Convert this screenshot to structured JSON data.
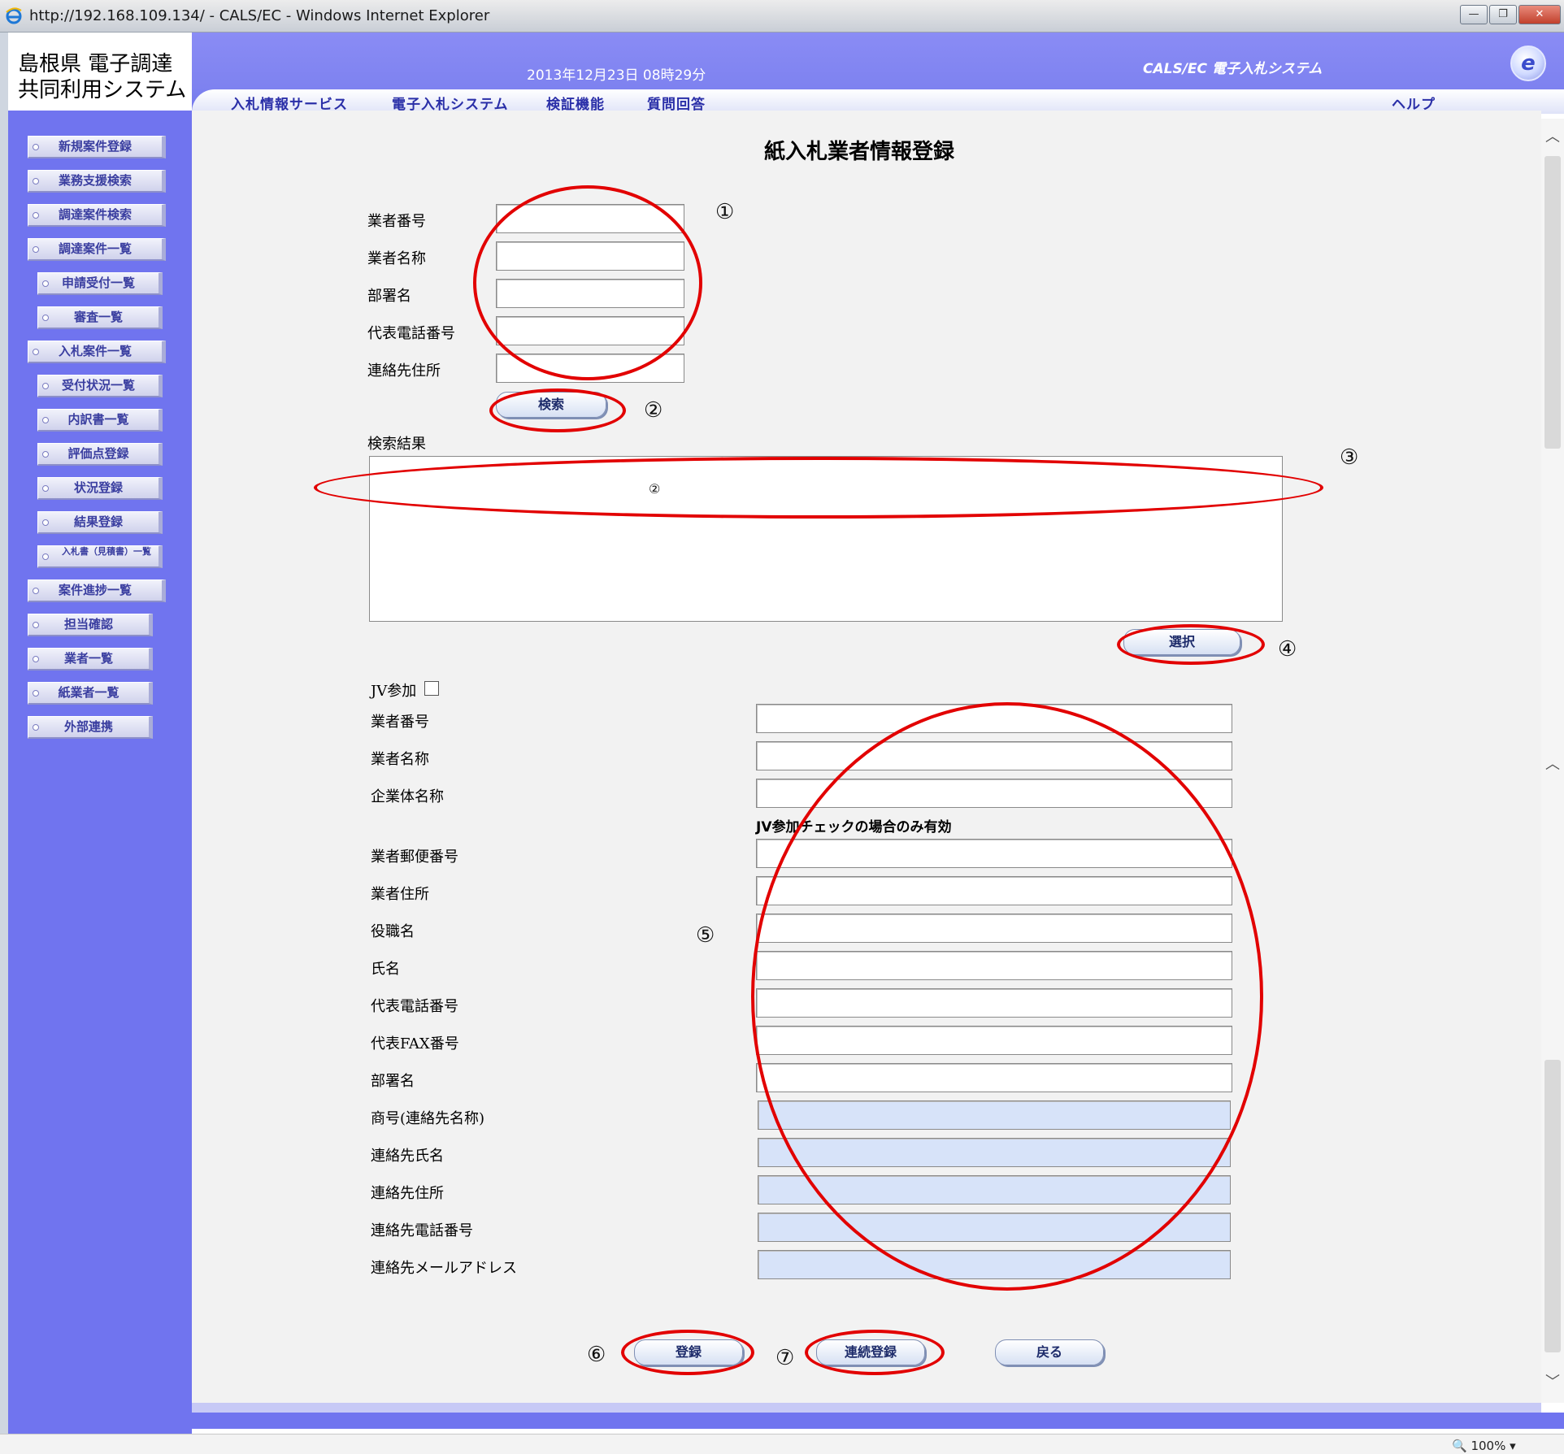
{
  "window": {
    "title": "http://192.168.109.134/ - CALS/EC - Windows Internet Explorer",
    "minimize": "—",
    "restore": "❐",
    "close": "✕"
  },
  "header": {
    "logo_line1": "島根県 電子調達",
    "logo_line2": "共同利用システム",
    "datetime": "2013年12月23日 08時29分",
    "system_name": "CALS/EC 電子入札システム",
    "menu": [
      "入札情報サービス",
      "電子入札システム",
      "検証機能",
      "質問回答"
    ],
    "help": "ヘルプ"
  },
  "sidebar": {
    "items": [
      "新規案件登録",
      "業務支援検索",
      "調達案件検索",
      "調達案件一覧",
      "申請受付一覧",
      "審査一覧",
      "入札案件一覧",
      "受付状況一覧",
      "内訳書一覧",
      "評価点登録",
      "状況登録",
      "結果登録",
      "入札書（見積書）一覧",
      "案件進捗一覧",
      "担当確認",
      "業者一覧",
      "紙業者一覧",
      "外部連携"
    ]
  },
  "page": {
    "title": "紙入札業者情報登録",
    "search": {
      "labels": [
        "業者番号",
        "業者名称",
        "部署名",
        "代表電話番号",
        "連絡先住所"
      ],
      "button": "検索",
      "result_label": "検索結果"
    },
    "select_button": "選択",
    "jv_label": "JV参加",
    "jv_note": "JV参加チェックの場合のみ有効",
    "form_labels": [
      "業者番号",
      "業者名称",
      "企業体名称",
      "業者郵便番号",
      "業者住所",
      "役職名",
      "氏名",
      "代表電話番号",
      "代表FAX番号",
      "部署名",
      "商号(連絡先名称)",
      "連絡先氏名",
      "連絡先住所",
      "連絡先電話番号",
      "連絡先メールアドレス"
    ],
    "buttons": {
      "register": "登録",
      "continuous_register": "連続登録",
      "back": "戻る"
    }
  },
  "annotations": {
    "markers": [
      "①",
      "②",
      "③",
      "④",
      "⑤",
      "⑥",
      "⑦"
    ],
    "inner_marker": "②"
  },
  "status": {
    "zoom": "100%"
  },
  "colors": {
    "annotation": "#e20000",
    "header": "#7e82f0",
    "sidebar": "#7074ef",
    "readonly_field": "#d7e3f9"
  }
}
